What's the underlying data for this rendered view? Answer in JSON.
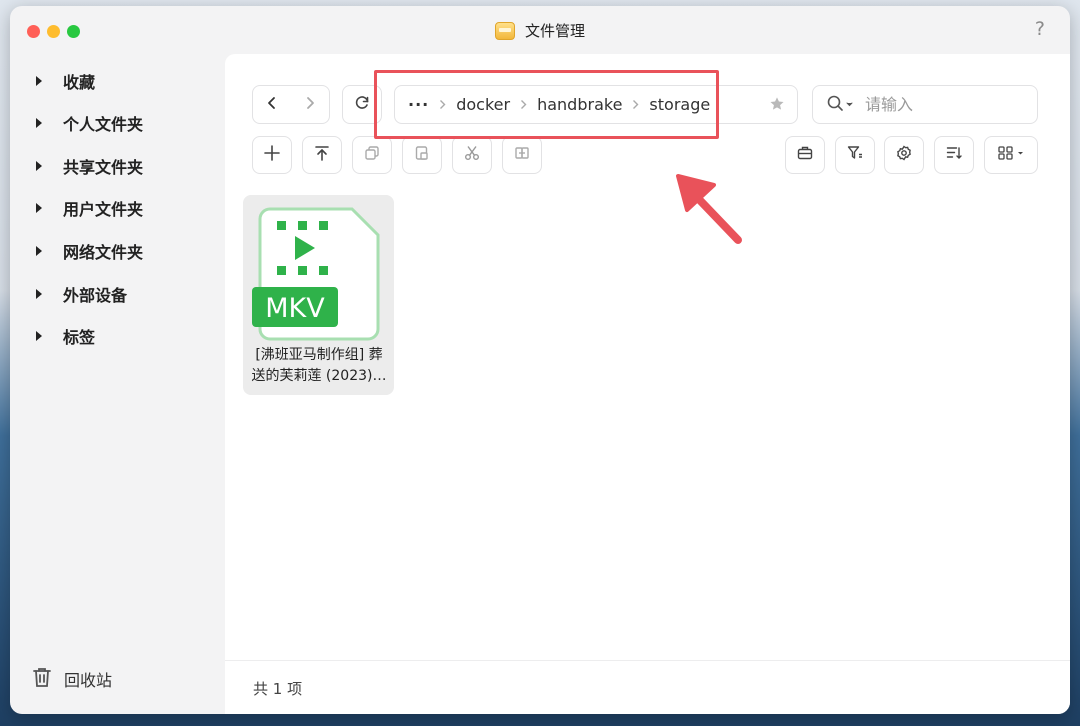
{
  "window": {
    "title": "文件管理",
    "help": "?"
  },
  "sidebar": {
    "items": [
      {
        "label": "收藏"
      },
      {
        "label": "个人文件夹"
      },
      {
        "label": "共享文件夹"
      },
      {
        "label": "用户文件夹"
      },
      {
        "label": "网络文件夹"
      },
      {
        "label": "外部设备"
      },
      {
        "label": "标签"
      }
    ],
    "trash": "回收站"
  },
  "path": {
    "more": "···",
    "crumbs": [
      "docker",
      "handbrake",
      "storage"
    ]
  },
  "search": {
    "placeholder": "请输入"
  },
  "files": [
    {
      "type_label": "MKV",
      "name": "[沸班亚马制作组] 葬送的芙莉莲 (2023)…"
    }
  ],
  "footer": {
    "count": "共 1 项"
  },
  "colors": {
    "accent_green": "#2fb24a",
    "highlight_red": "#e9525a"
  }
}
